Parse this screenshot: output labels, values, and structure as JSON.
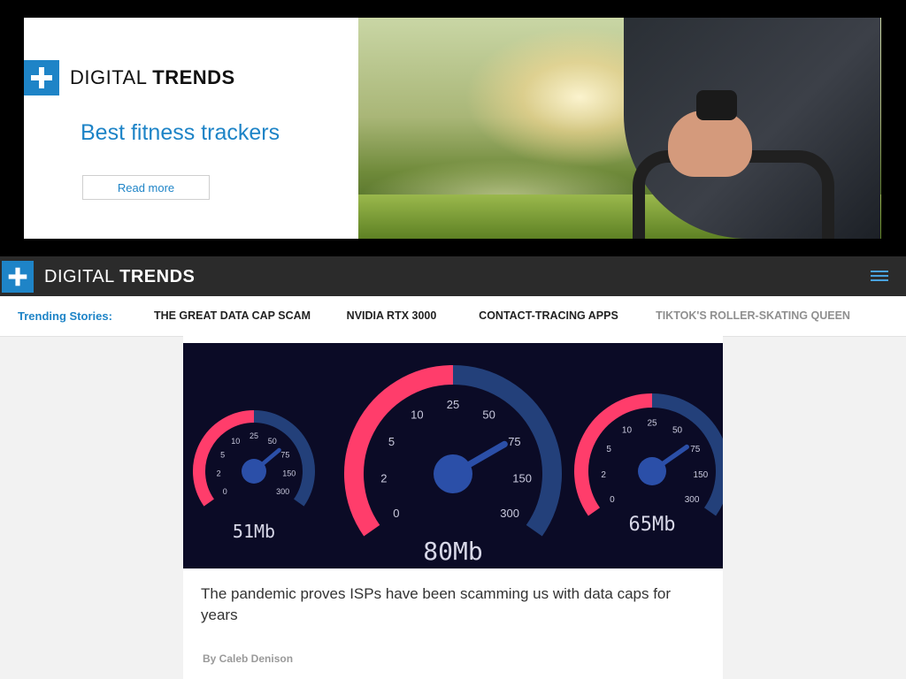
{
  "ad": {
    "brand": {
      "word_light": "DIGITAL ",
      "word_bold": "TRENDS"
    },
    "headline": "Best fitness trackers",
    "cta": "Read more",
    "photo_icon": "fitness-pushup-photo"
  },
  "header": {
    "brand": {
      "word_light": "DIGITAL ",
      "word_bold": "TRENDS"
    },
    "menu_icon": "hamburger-menu-icon"
  },
  "trending": {
    "lead": "Trending Stories:",
    "items": [
      "THE GREAT DATA CAP SCAM",
      "NVIDIA RTX 3000",
      "CONTACT-TRACING APPS",
      "TIKTOK'S ROLLER-SKATING QUEEN"
    ]
  },
  "article": {
    "image_icon": "speedometer-gauges-image",
    "gauges": [
      {
        "label": "51Mb",
        "ticks": [
          "0",
          "2",
          "5",
          "10",
          "25",
          "50",
          "75",
          "150",
          "300"
        ]
      },
      {
        "label": "80Mb",
        "ticks": [
          "0",
          "2",
          "5",
          "10",
          "25",
          "50",
          "75",
          "150",
          "300"
        ]
      },
      {
        "label": "65Mb",
        "ticks": [
          "0",
          "2",
          "5",
          "10",
          "25",
          "50",
          "75",
          "150",
          "300"
        ]
      }
    ],
    "title": "The pandemic proves ISPs have been scamming us with data caps for years",
    "author": "By Caleb Denison"
  },
  "colors": {
    "brand_blue": "#1e84c7",
    "header_dark": "#2b2b2b",
    "gauge_pink": "#ff3d6b",
    "gauge_navy": "#23407a"
  }
}
